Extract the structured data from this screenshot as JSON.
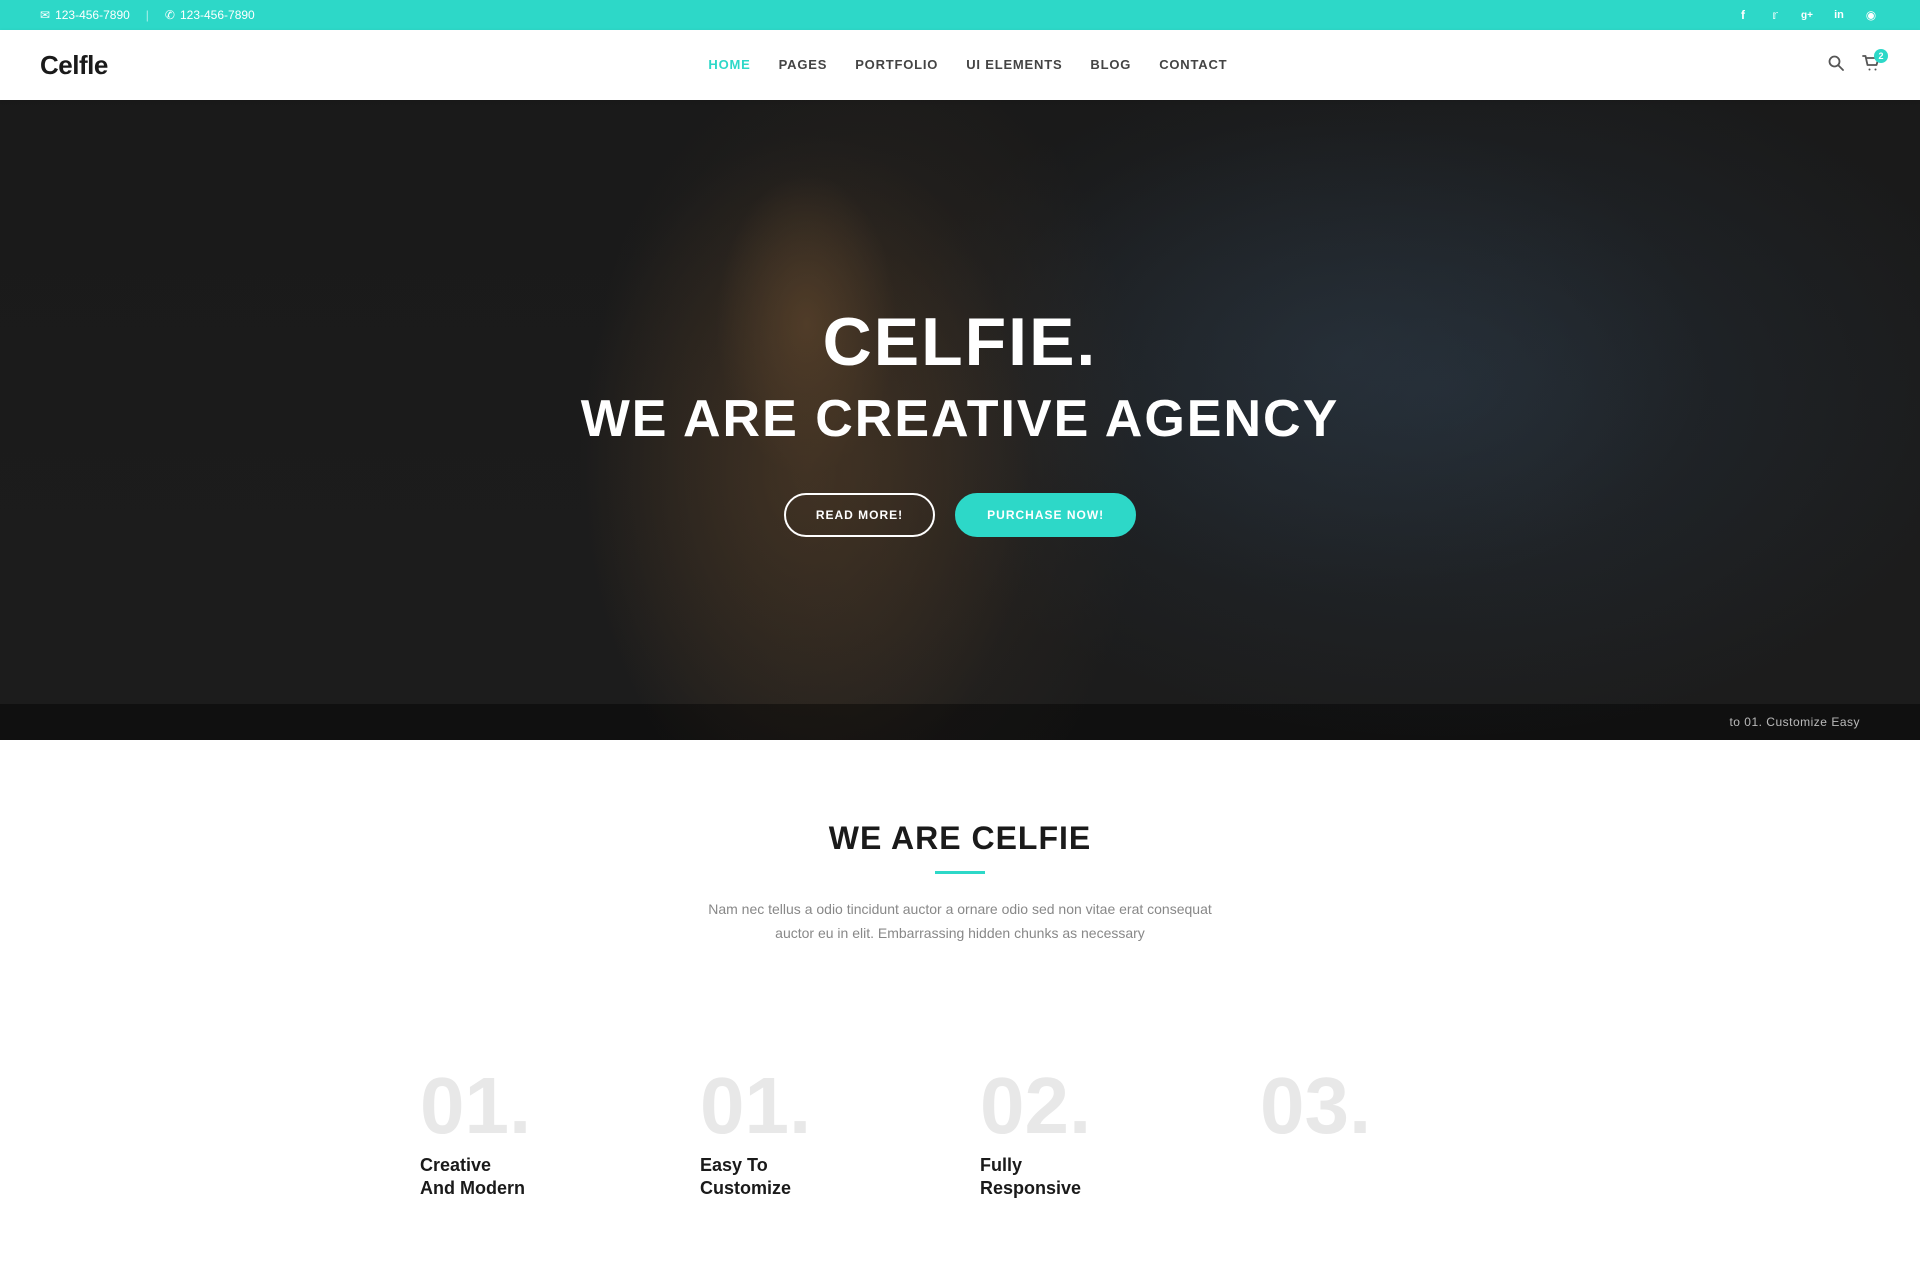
{
  "topbar": {
    "email": "123-456-7890",
    "phone": "123-456-7890",
    "email_icon": "✉",
    "phone_icon": "✆",
    "divider": "|",
    "social": [
      {
        "name": "facebook",
        "icon": "f"
      },
      {
        "name": "twitter",
        "icon": "t"
      },
      {
        "name": "googleplus",
        "icon": "g+"
      },
      {
        "name": "linkedin",
        "icon": "in"
      },
      {
        "name": "rss",
        "icon": "rss"
      }
    ]
  },
  "navbar": {
    "logo": "Celfle",
    "nav_items": [
      {
        "label": "HOME",
        "active": true
      },
      {
        "label": "PAGES",
        "active": false
      },
      {
        "label": "PORTFOLIO",
        "active": false
      },
      {
        "label": "UI ELEMENTS",
        "active": false
      },
      {
        "label": "BLOG",
        "active": false
      },
      {
        "label": "CONTACT",
        "active": false
      }
    ],
    "cart_count": "2"
  },
  "hero": {
    "title_main": "CELFIE.",
    "title_sub": "WE ARE CREATIVE AGENCY",
    "btn_read_more": "READ MORE!",
    "btn_purchase": "PURCHASE NOW!"
  },
  "about": {
    "title": "WE ARE CELFIE",
    "description": "Nam nec tellus a odio tincidunt auctor a ornare odio sed non vitae erat consequat auctor eu in elit. Embarrassing hidden chunks as necessary"
  },
  "features": [
    {
      "number": "01.",
      "title_line1": "Creative",
      "title_line2": "and Modern"
    },
    {
      "number": "01.",
      "title_line1": "Easy to",
      "title_line2": "Customize"
    },
    {
      "number": "02.",
      "title_line1": "Fully",
      "title_line2": "Responsive"
    },
    {
      "number": "03.",
      "title_line1": "",
      "title_line2": ""
    }
  ],
  "bottom_scroll": "to 01. Customize Easy",
  "colors": {
    "accent": "#2dd8c8",
    "dark": "#1a1a1a",
    "gray": "#888888",
    "light_gray": "#e8e8e8"
  }
}
